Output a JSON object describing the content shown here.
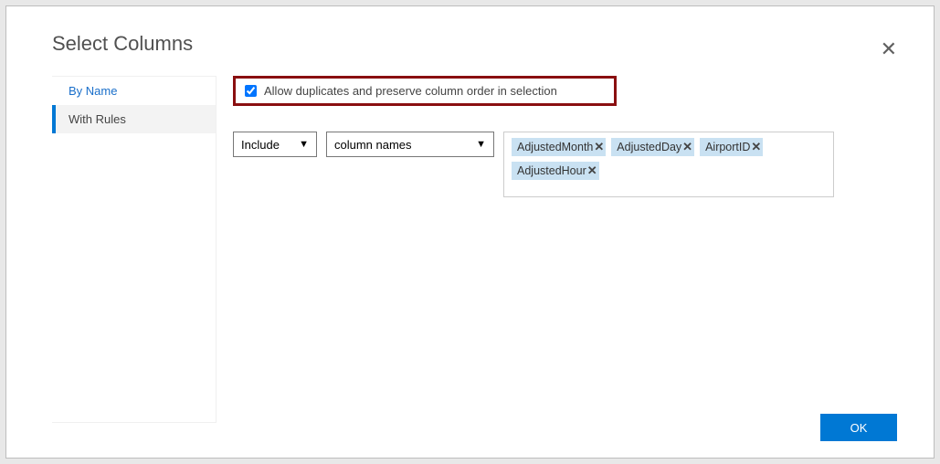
{
  "title": "Select Columns",
  "sidebar": {
    "items": [
      {
        "label": "By Name"
      },
      {
        "label": "With Rules"
      }
    ]
  },
  "checkbox": {
    "label": "Allow duplicates and preserve column order in selection",
    "checked": true
  },
  "rule": {
    "mode": "Include",
    "by": "column names",
    "columns": [
      "AdjustedMonth",
      "AdjustedDay",
      "AirportID",
      "AdjustedHour"
    ]
  },
  "buttons": {
    "ok": "OK"
  },
  "colors": {
    "accent": "#0078d4",
    "highlight_border": "#8a0f10",
    "chip_bg": "#c9e1f2"
  }
}
